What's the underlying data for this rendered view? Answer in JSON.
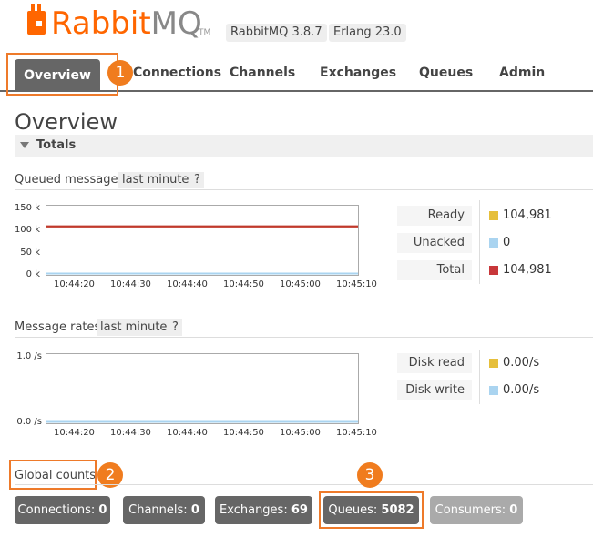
{
  "brand": {
    "name_part1": "Rabbit",
    "name_part2": "MQ",
    "tm": "TM"
  },
  "versions": {
    "rabbitmq": "RabbitMQ 3.8.7",
    "erlang": "Erlang 23.0"
  },
  "nav": {
    "tabs": [
      "Overview",
      "Connections",
      "Channels",
      "Exchanges",
      "Queues",
      "Admin"
    ],
    "active": "Overview"
  },
  "callouts": [
    "1",
    "2",
    "3"
  ],
  "page": {
    "title": "Overview",
    "section": "Totals"
  },
  "queued": {
    "label": "Queued messages",
    "range": "last minute",
    "help": "?",
    "chart_data": {
      "type": "line",
      "x": [
        "10:44:20",
        "10:44:30",
        "10:44:40",
        "10:44:50",
        "10:45:00",
        "10:45:10"
      ],
      "yticks": [
        "150 k",
        "100 k",
        "50 k",
        "0 k"
      ],
      "ylim": [
        0,
        150000
      ],
      "series": [
        {
          "name": "Ready",
          "color": "#c0392b",
          "values": [
            104981,
            104981,
            104981,
            104981,
            104981,
            104981
          ]
        },
        {
          "name": "Unacked",
          "color": "#aad4f0",
          "values": [
            0,
            0,
            0,
            0,
            0,
            0
          ]
        },
        {
          "name": "Total",
          "color": "#c0392b",
          "values": [
            104981,
            104981,
            104981,
            104981,
            104981,
            104981
          ]
        }
      ]
    },
    "legend": [
      {
        "label": "Ready",
        "value": "104,981",
        "color": "#e6bf3b"
      },
      {
        "label": "Unacked",
        "value": "0",
        "color": "#aad4f0"
      },
      {
        "label": "Total",
        "value": "104,981",
        "color": "#c8373a"
      }
    ]
  },
  "rates": {
    "label": "Message rates",
    "range": "last minute",
    "help": "?",
    "chart_data": {
      "type": "line",
      "x": [
        "10:44:20",
        "10:44:30",
        "10:44:40",
        "10:44:50",
        "10:45:00",
        "10:45:10"
      ],
      "yticks": [
        "1.0 /s",
        "0.0 /s"
      ],
      "ylim": [
        0,
        1
      ],
      "series": [
        {
          "name": "Disk read",
          "color": "#e6bf3b",
          "values": [
            0,
            0,
            0,
            0,
            0,
            0
          ]
        },
        {
          "name": "Disk write",
          "color": "#aad4f0",
          "values": [
            0,
            0,
            0,
            0,
            0,
            0
          ]
        }
      ]
    },
    "legend": [
      {
        "label": "Disk read",
        "value": "0.00/s",
        "color": "#e6bf3b"
      },
      {
        "label": "Disk write",
        "value": "0.00/s",
        "color": "#aad4f0"
      }
    ]
  },
  "global": {
    "title": "Global counts",
    "counts": [
      {
        "label": "Connections:",
        "value": "0"
      },
      {
        "label": "Channels:",
        "value": "0"
      },
      {
        "label": "Exchanges:",
        "value": "69"
      },
      {
        "label": "Queues:",
        "value": "5082"
      },
      {
        "label": "Consumers:",
        "value": "0"
      }
    ]
  }
}
